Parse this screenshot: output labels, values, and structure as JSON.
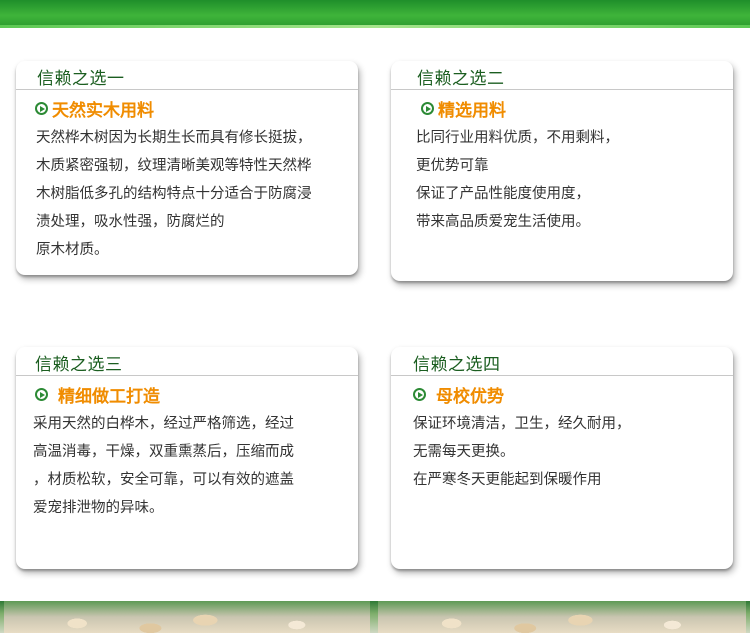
{
  "cards": [
    {
      "title": "信赖之选一",
      "subtitle": "天然实木用料",
      "lines": [
        "天然桦木树因为长期生长而具有修长挺拔，",
        "木质紧密强韧，纹理清晰美观等特性天然桦",
        "木树脂低多孔的结构特点十分适合于防腐浸",
        "渍处理，吸水性强，防腐烂的",
        "原木材质。"
      ]
    },
    {
      "title": "信赖之选二",
      "subtitle": "精选用料",
      "lines": [
        "比同行业用料优质，不用剩料，",
        "更优势可靠",
        "保证了产品性能度使用度，",
        "带来高品质爱宠生活使用。"
      ]
    },
    {
      "title": "信赖之选三",
      "subtitle": "精细做工打造",
      "lines": [
        "采用天然的白桦木，经过严格筛选，经过",
        "高温消毒，干燥，双重熏蒸后，压缩而成",
        "，材质松软，安全可靠，可以有效的遮盖",
        "爱宠排泄物的异味。"
      ]
    },
    {
      "title": "信赖之选四",
      "subtitle": "母校优势",
      "lines": [
        "保证环境清洁，卫生，经久耐用，",
        "无需每天更换。",
        "在严寒冬天更能起到保暖作用"
      ]
    }
  ],
  "colors": {
    "title": "#1b5e20",
    "subtitle": "#f08c00",
    "icon": "#2c8a35",
    "band": "#3fb43a"
  },
  "icons": {
    "subtitle_bullet": "circle-arrow-icon"
  }
}
